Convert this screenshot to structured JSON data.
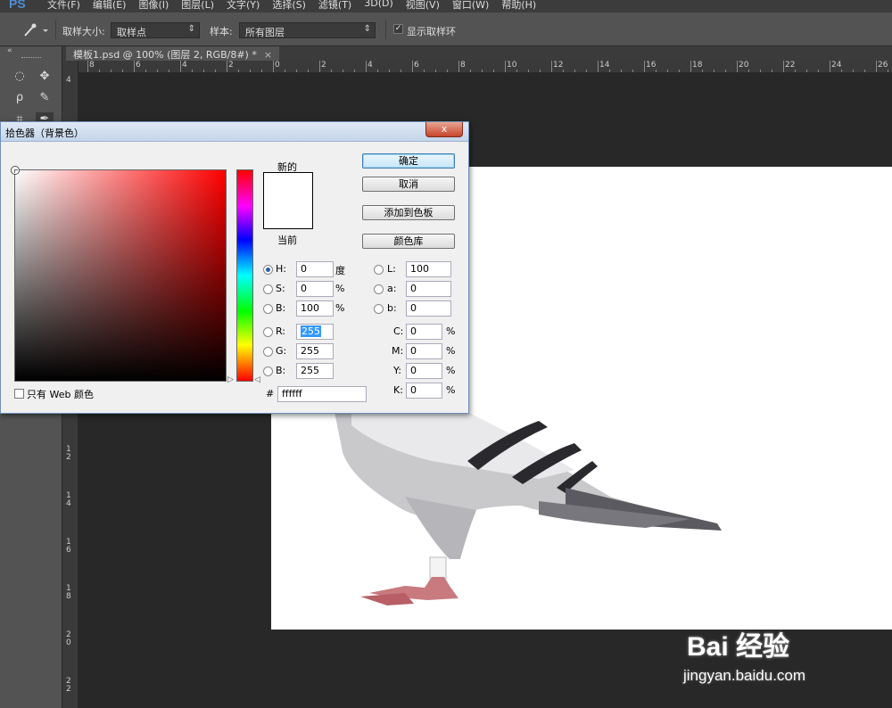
{
  "app": {
    "logo": "PS",
    "menu": [
      "文件(F)",
      "编辑(E)",
      "图像(I)",
      "图层(L)",
      "文字(Y)",
      "选择(S)",
      "滤镜(T)",
      "3D(D)",
      "视图(V)",
      "窗口(W)",
      "帮助(H)"
    ]
  },
  "options_bar": {
    "sample_size_label": "取样大小:",
    "sample_size_value": "取样点",
    "sample_label": "样本:",
    "sample_value": "所有图层",
    "show_ring_label": "显示取样环",
    "show_ring_checked": true
  },
  "document": {
    "tab_label": "模板1.psd @ 100% (图层 2, RGB/8#) *",
    "close": "×"
  },
  "rulers": {
    "top": [
      "8",
      "6",
      "4",
      "2",
      "0",
      "2",
      "4",
      "6",
      "8",
      "10",
      "12",
      "14",
      "16",
      "18",
      "20",
      "22",
      "24",
      "26"
    ],
    "left": [
      "4",
      "12",
      "14",
      "16",
      "18",
      "20",
      "22"
    ]
  },
  "dialog": {
    "title": "拾色器（背景色）",
    "close": "x",
    "new_label": "新的",
    "current_label": "当前",
    "buttons": {
      "ok": "确定",
      "cancel": "取消",
      "add_swatch": "添加到色板",
      "libraries": "颜色库"
    },
    "hsb": {
      "h": {
        "label": "H:",
        "value": "0",
        "unit": "度",
        "selected": true
      },
      "s": {
        "label": "S:",
        "value": "0",
        "unit": "%"
      },
      "b": {
        "label": "B:",
        "value": "100",
        "unit": "%"
      }
    },
    "rgb": {
      "r": {
        "label": "R:",
        "value": "255"
      },
      "g": {
        "label": "G:",
        "value": "255"
      },
      "b": {
        "label": "B:",
        "value": "255"
      }
    },
    "lab": {
      "l": {
        "label": "L:",
        "value": "100"
      },
      "a": {
        "label": "a:",
        "value": "0"
      },
      "b": {
        "label": "b:",
        "value": "0"
      }
    },
    "cmyk": {
      "c": {
        "label": "C:",
        "value": "0",
        "unit": "%"
      },
      "m": {
        "label": "M:",
        "value": "0",
        "unit": "%"
      },
      "y": {
        "label": "Y:",
        "value": "0",
        "unit": "%"
      },
      "k": {
        "label": "K:",
        "value": "0",
        "unit": "%"
      }
    },
    "hex_label": "#",
    "hex_value": "ffffff",
    "web_only_label": "只有 Web 颜色",
    "new_color": "#ffffff"
  },
  "watermark": {
    "logo": "Bai 经验",
    "url": "jingyan.baidu.com"
  }
}
